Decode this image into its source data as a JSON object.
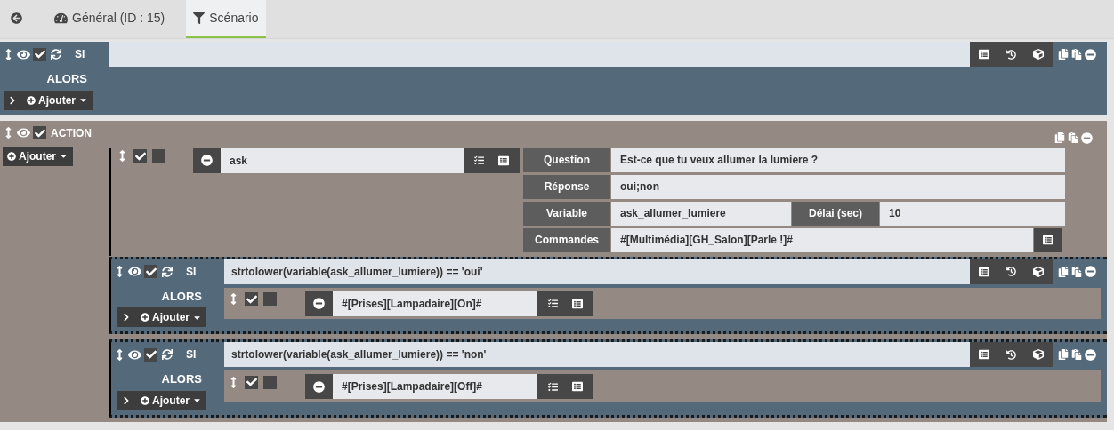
{
  "tabs": [
    {
      "kind": "back",
      "selected": false
    },
    {
      "kind": "general",
      "label": "Général (ID : 15)",
      "selected": false
    },
    {
      "kind": "scenario",
      "label": "Scénario",
      "selected": true
    }
  ],
  "blocks": [
    {
      "kind": "if",
      "keyword": "SI",
      "enabled": true,
      "then_label": "ALORS",
      "add_label": "Ajouter"
    },
    {
      "kind": "action",
      "keyword": "ACTION",
      "enabled": true,
      "add_label": "Ajouter",
      "elements": [
        {
          "kind": "action",
          "enabled": true,
          "parallel": false,
          "command": "ask",
          "options": [
            {
              "kind": "text",
              "fields": [
                {
                  "label": "Question",
                  "value": "Est-ce que tu veux allumer la lumiere ?"
                }
              ]
            },
            {
              "kind": "text",
              "fields": [
                {
                  "label": "Réponse",
                  "value": "oui;non"
                }
              ]
            },
            {
              "kind": "text",
              "fields": [
                {
                  "label": "Variable",
                  "value": "ask_allumer_lumiere"
                },
                {
                  "label": "Délai (sec)",
                  "value": "10"
                }
              ]
            },
            {
              "kind": "command",
              "fields": [
                {
                  "label": "Commandes",
                  "value": "#[Multimédia][GH_Salon][Parle !]#"
                }
              ]
            }
          ]
        },
        {
          "kind": "if",
          "keyword": "SI",
          "enabled": true,
          "condition": "strtolower(variable(ask_allumer_lumiere)) == 'oui'",
          "then_label": "ALORS",
          "add_label": "Ajouter",
          "actions": [
            {
              "enabled": true,
              "parallel": false,
              "command": "#[Prises][Lampadaire][On]#"
            }
          ]
        },
        {
          "kind": "if",
          "keyword": "SI",
          "enabled": true,
          "condition": "strtolower(variable(ask_allumer_lumiere)) == 'non'",
          "then_label": "ALORS",
          "add_label": "Ajouter",
          "actions": [
            {
              "enabled": true,
              "parallel": false,
              "command": "#[Prises][Lampadaire][Off]#"
            }
          ]
        }
      ]
    }
  ]
}
